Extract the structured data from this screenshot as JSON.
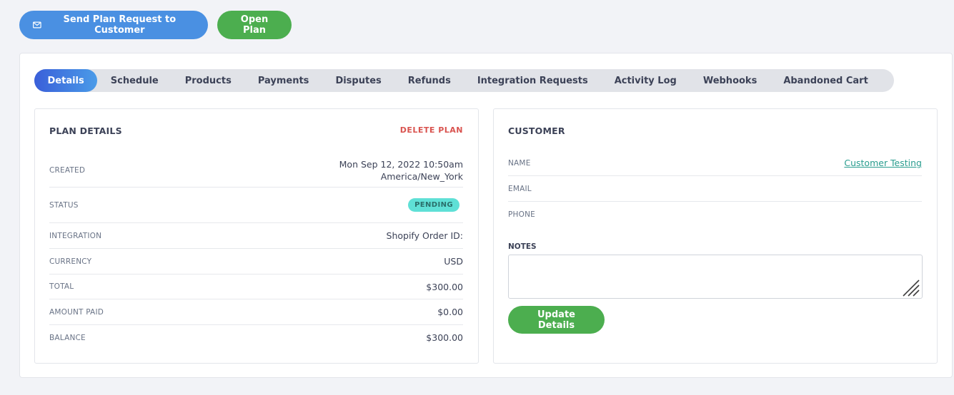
{
  "header": {
    "send_plan_label": "Send Plan Request to Customer",
    "open_plan_label": "Open Plan"
  },
  "tabs": [
    {
      "label": "Details",
      "active": true
    },
    {
      "label": "Schedule"
    },
    {
      "label": "Products"
    },
    {
      "label": "Payments"
    },
    {
      "label": "Disputes"
    },
    {
      "label": "Refunds"
    },
    {
      "label": "Integration Requests"
    },
    {
      "label": "Activity Log"
    },
    {
      "label": "Webhooks"
    },
    {
      "label": "Abandoned Cart"
    }
  ],
  "plan_details": {
    "title": "PLAN DETAILS",
    "delete_label": "DELETE PLAN",
    "created_label": "CREATED",
    "created_value_line1": "Mon Sep 12, 2022 10:50am",
    "created_value_line2": "America/New_York",
    "status_label": "STATUS",
    "status_value": "PENDING",
    "integration_label": "INTEGRATION",
    "integration_value": "Shopify Order ID:",
    "currency_label": "CURRENCY",
    "currency_value": "USD",
    "total_label": "TOTAL",
    "total_value": "$300.00",
    "amount_paid_label": "AMOUNT PAID",
    "amount_paid_value": "$0.00",
    "balance_label": "BALANCE",
    "balance_value": "$300.00"
  },
  "customer": {
    "title": "CUSTOMER",
    "name_label": "NAME",
    "name_value": "Customer Testing",
    "email_label": "EMAIL",
    "phone_label": "PHONE",
    "notes_label": "NOTES",
    "update_label": "Update Details"
  },
  "colors": {
    "primary_blue": "#4a90e2",
    "green": "#4cae4f",
    "danger": "#d9534f",
    "badge_teal": "#5fe0d6",
    "link_teal": "#2a9d8f"
  },
  "icons": {
    "send_button_icon": "mail-icon",
    "notes_resize_icon": "resize-handle-icon"
  }
}
